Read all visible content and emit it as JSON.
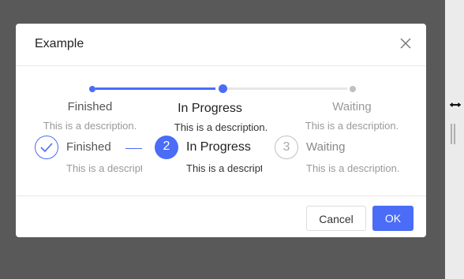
{
  "modal": {
    "title": "Example",
    "cancel_label": "Cancel",
    "ok_label": "OK"
  },
  "dot_steps": [
    {
      "title": "Finished",
      "description": "This is a description.",
      "status": "finished"
    },
    {
      "title": "In Progress",
      "description": "This is a description.",
      "status": "process"
    },
    {
      "title": "Waiting",
      "description": "This is a description.",
      "status": "wait"
    }
  ],
  "icon_steps": [
    {
      "title": "Finished",
      "description": "This is a description.",
      "status": "finished",
      "icon": "check-icon"
    },
    {
      "title": "In Progress",
      "description": "This is a description.",
      "status": "process",
      "number": "2"
    },
    {
      "title": "Waiting",
      "description": "This is a description.",
      "status": "wait",
      "number": "3"
    }
  ],
  "colors": {
    "primary": "#4a6cf7",
    "wait": "#c0c0c0",
    "overlay": "#595959"
  }
}
